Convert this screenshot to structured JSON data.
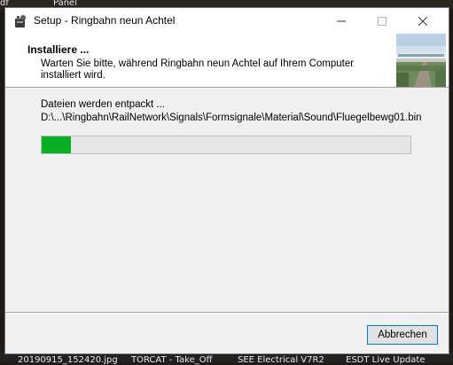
{
  "desktop": {
    "top_labels": [
      "df",
      "Panel"
    ],
    "taskbar_labels": [
      "20190915_152420.jpg",
      "TORCAT - Take_Off",
      "SEE Electrical V7R2",
      "ESDT Live Update"
    ]
  },
  "window": {
    "title": "Setup - Ringbahn neun Achtel",
    "icons": {
      "app": "setup-app-icon",
      "minimize": "minimize-icon",
      "maximize": "maximize-icon",
      "close": "close-icon"
    }
  },
  "header": {
    "title": "Installiere ...",
    "description": "Warten Sie bitte, während Ringbahn neun Achtel auf Ihrem Computer installiert wird.",
    "image": "railway-banner-image"
  },
  "main": {
    "status": "Dateien werden entpackt ...",
    "file_path": "D:\\...\\Ringbahn\\RailNetwork\\Signals\\Formsignale\\Material\\Sound\\Fluegelbewg01.bin",
    "progress_percent": 8,
    "progress_color": "#06b025"
  },
  "footer": {
    "cancel_label": "Abbrechen"
  }
}
